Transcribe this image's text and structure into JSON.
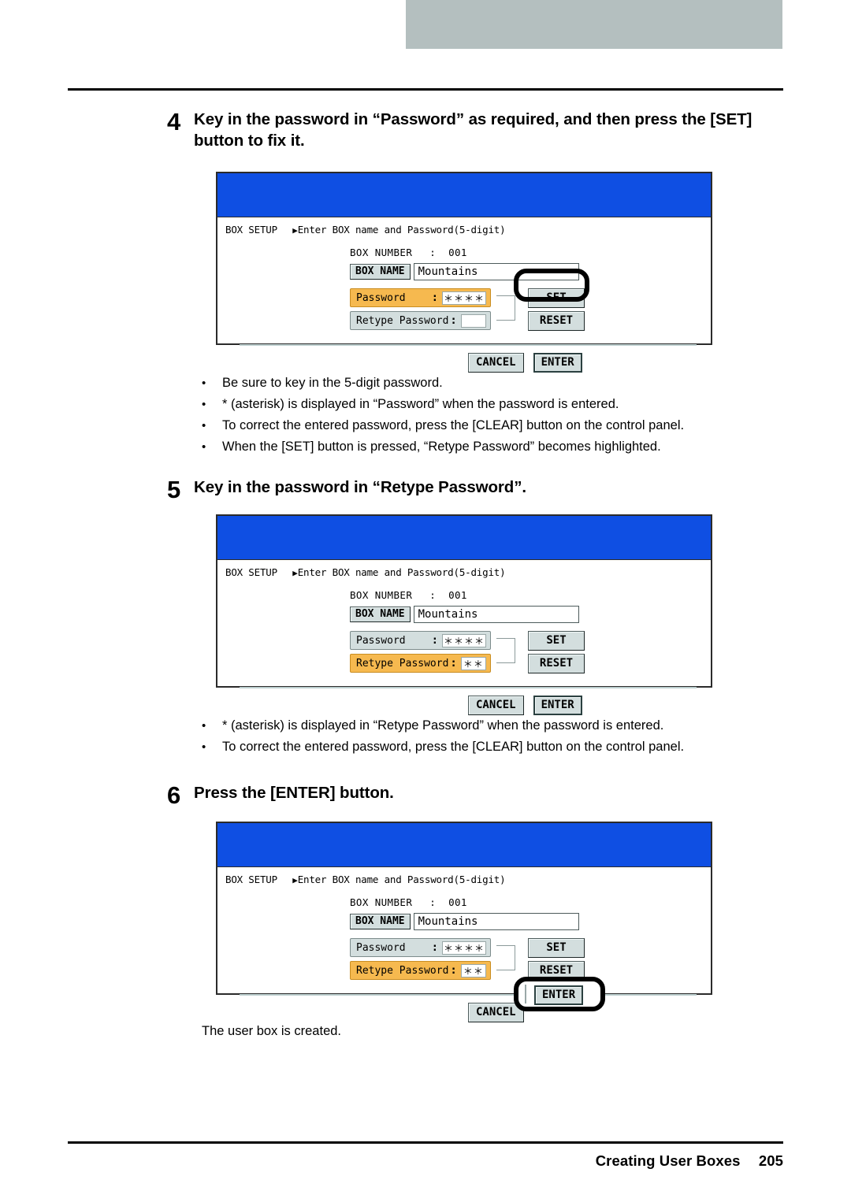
{
  "page": {
    "footer_title": "Creating User Boxes",
    "page_number": "205"
  },
  "colors": {
    "header_band": "#b4bfbf",
    "lcd_blue": "#0f4fe3",
    "highlight_orange": "#f6b94f",
    "lcd_button": "#d3dede",
    "separator": "#bdcfcf"
  },
  "steps": [
    {
      "number": "4",
      "text": "Key in the password in “Password” as required, and then press the [SET] button to fix it."
    },
    {
      "number": "5",
      "text": "Key in the password in “Retype Password”."
    },
    {
      "number": "6",
      "text": "Press the [ENTER] button."
    }
  ],
  "notes_after_step4": [
    {
      "dot": "•",
      "text": "Be sure to key in the 5-digit password."
    },
    {
      "dot": "•",
      "text": "* (asterisk) is displayed in “Password” when the password is entered."
    },
    {
      "dot": "•",
      "text": "To correct the entered password, press the [CLEAR] button on the control panel."
    },
    {
      "dot": "•",
      "text": "When the [SET] button is pressed, “Retype Password” becomes highlighted."
    }
  ],
  "notes_after_step5": [
    {
      "dot": "•",
      "text": " * (asterisk) is displayed in “Retype Password” when the password is entered."
    },
    {
      "dot": "•",
      "text": "To correct the entered password, press the [CLEAR] button on the control panel."
    }
  ],
  "note_after_step6": "The user box is created.",
  "panels": [
    {
      "id": "panel-step4",
      "breadcrumb_root": "BOX SETUP",
      "breadcrumb_arrow": "▶",
      "breadcrumb_leaf": "Enter BOX name and Password(5-digit)",
      "box_number_label": "BOX NUMBER",
      "box_number_colon": ":",
      "box_number_value": "001",
      "box_name_button": "BOX NAME",
      "box_name_value": "Mountains",
      "password_label": "Password",
      "password_value": "＊＊＊＊＊",
      "retype_label": "Retype Password",
      "retype_value": "",
      "set_button": "SET",
      "reset_button": "RESET",
      "cancel_button": "CANCEL",
      "enter_button": "ENTER"
    },
    {
      "id": "panel-step5",
      "breadcrumb_root": "BOX SETUP",
      "breadcrumb_arrow": "▶",
      "breadcrumb_leaf": "Enter BOX name and Password(5-digit)",
      "box_number_label": "BOX NUMBER",
      "box_number_colon": ":",
      "box_number_value": "001",
      "box_name_button": "BOX NAME",
      "box_name_value": "Mountains",
      "password_label": "Password",
      "password_value": "＊＊＊＊＊",
      "retype_label": "Retype Password",
      "retype_value": "＊＊＊＊＊",
      "set_button": "SET",
      "reset_button": "RESET",
      "cancel_button": "CANCEL",
      "enter_button": "ENTER"
    },
    {
      "id": "panel-step6",
      "breadcrumb_root": "BOX SETUP",
      "breadcrumb_arrow": "▶",
      "breadcrumb_leaf": "Enter BOX name and Password(5-digit)",
      "box_number_label": "BOX NUMBER",
      "box_number_colon": ":",
      "box_number_value": "001",
      "box_name_button": "BOX NAME",
      "box_name_value": "Mountains",
      "password_label": "Password",
      "password_value": "＊＊＊＊＊",
      "retype_label": "Retype Password",
      "retype_value": "＊＊＊＊＊",
      "set_button": "SET",
      "reset_button": "RESET",
      "cancel_button": "CANCEL",
      "enter_button": "ENTER"
    }
  ]
}
